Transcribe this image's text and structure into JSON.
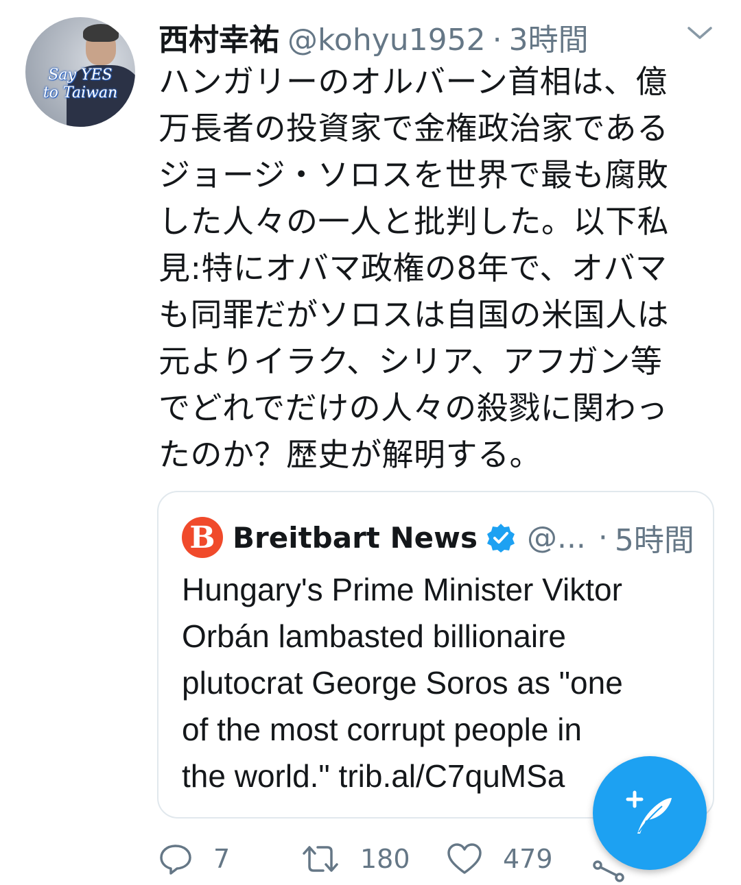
{
  "tweet": {
    "display_name": "西村幸祐",
    "handle": "@kohyu1952",
    "separator": "·",
    "time": "3時間",
    "avatar_text_line1": "Say YES",
    "avatar_text_line2": "to Taiwan",
    "text_lines": [
      "ハンガリーのオルバーン首相は、億",
      "万長者の投資家で金権政治家である",
      "ジョージ・ソロスを世界で最も腐敗",
      "した人々の一人と批判した。以下私",
      "見:特にオバマ政権の8年で、オバマ",
      "も同罪だがソロスは自国の米国人は",
      "元よりイラク、シリア、アフガン等",
      "でどれでだけの人々の殺戮に関わっ",
      "たのか？歴史が解明する。"
    ]
  },
  "quote": {
    "logo_letter": "B",
    "name": "Breitbart News",
    "handle": "@...",
    "separator": "·",
    "time": "5時間",
    "text_lines": [
      "Hungary's Prime Minister Viktor",
      "Orbán lambasted billionaire",
      "plutocrat George Soros as \"one",
      "of the most corrupt people in",
      "the world.\" trib.al/C7quMSa"
    ]
  },
  "actions": {
    "reply_count": "7",
    "retweet_count": "180",
    "like_count": "479"
  },
  "icons": {
    "menu": "chevron-down-icon",
    "verified": "verified-badge-icon",
    "reply": "reply-icon",
    "retweet": "retweet-icon",
    "like": "heart-icon",
    "share": "share-icon",
    "compose": "compose-tweet-icon"
  },
  "colors": {
    "primary_text": "#14171a",
    "secondary_text": "#657786",
    "accent": "#1da1f2",
    "breitbart_red": "#f04a2b",
    "card_border": "#e1e8ed"
  }
}
